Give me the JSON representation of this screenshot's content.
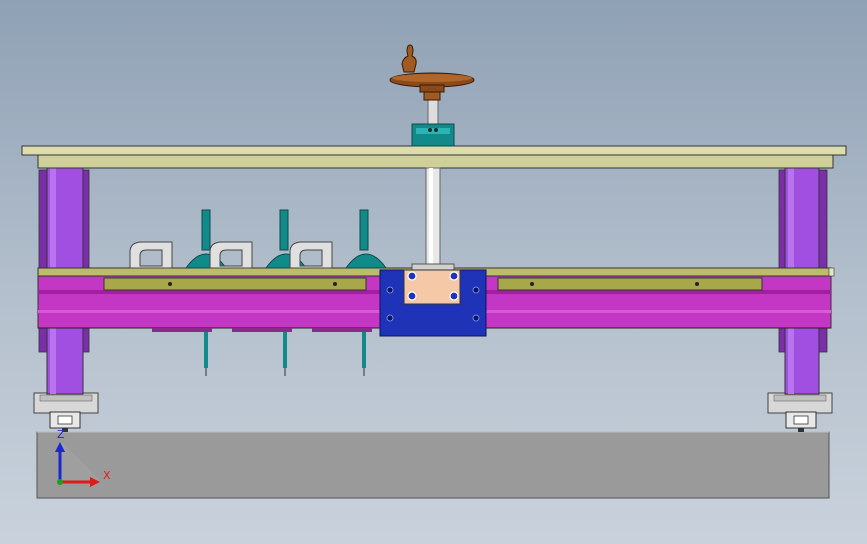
{
  "window": {
    "kind": "cad-3d-viewport"
  },
  "colors": {
    "background_top": "#8fa1b5",
    "background_bottom": "#c9d2dc",
    "table_top": "#d8d8a8",
    "leg_purple": "#a04fe0",
    "frame_magenta": "#c437c4",
    "rail_olive": "#a8a84a",
    "carriage_blue": "#1f33b8",
    "bracket_teal": "#138a8a",
    "handwheel_brown": "#8a4a1a",
    "base_grey": "#9a9a9a",
    "axis_z": "#1a2ad0",
    "axis_x": "#e01a1a",
    "axis_origin": "#1aa01a"
  },
  "triad": {
    "z_label": "Z",
    "x_label": "X",
    "icons": [
      "axis-z-arrow-icon",
      "axis-x-arrow-icon",
      "axis-origin-icon"
    ]
  },
  "model": {
    "parts": [
      "handwheel",
      "lead-screw",
      "screw-mount-block",
      "table-top-plate",
      "left-leg",
      "right-leg",
      "cross-beam-frame",
      "guide-rail",
      "carriage-plate",
      "clamp-assembly-1",
      "clamp-assembly-2",
      "clamp-assembly-3",
      "linear-bearing-left",
      "linear-bearing-right",
      "base-block"
    ]
  }
}
